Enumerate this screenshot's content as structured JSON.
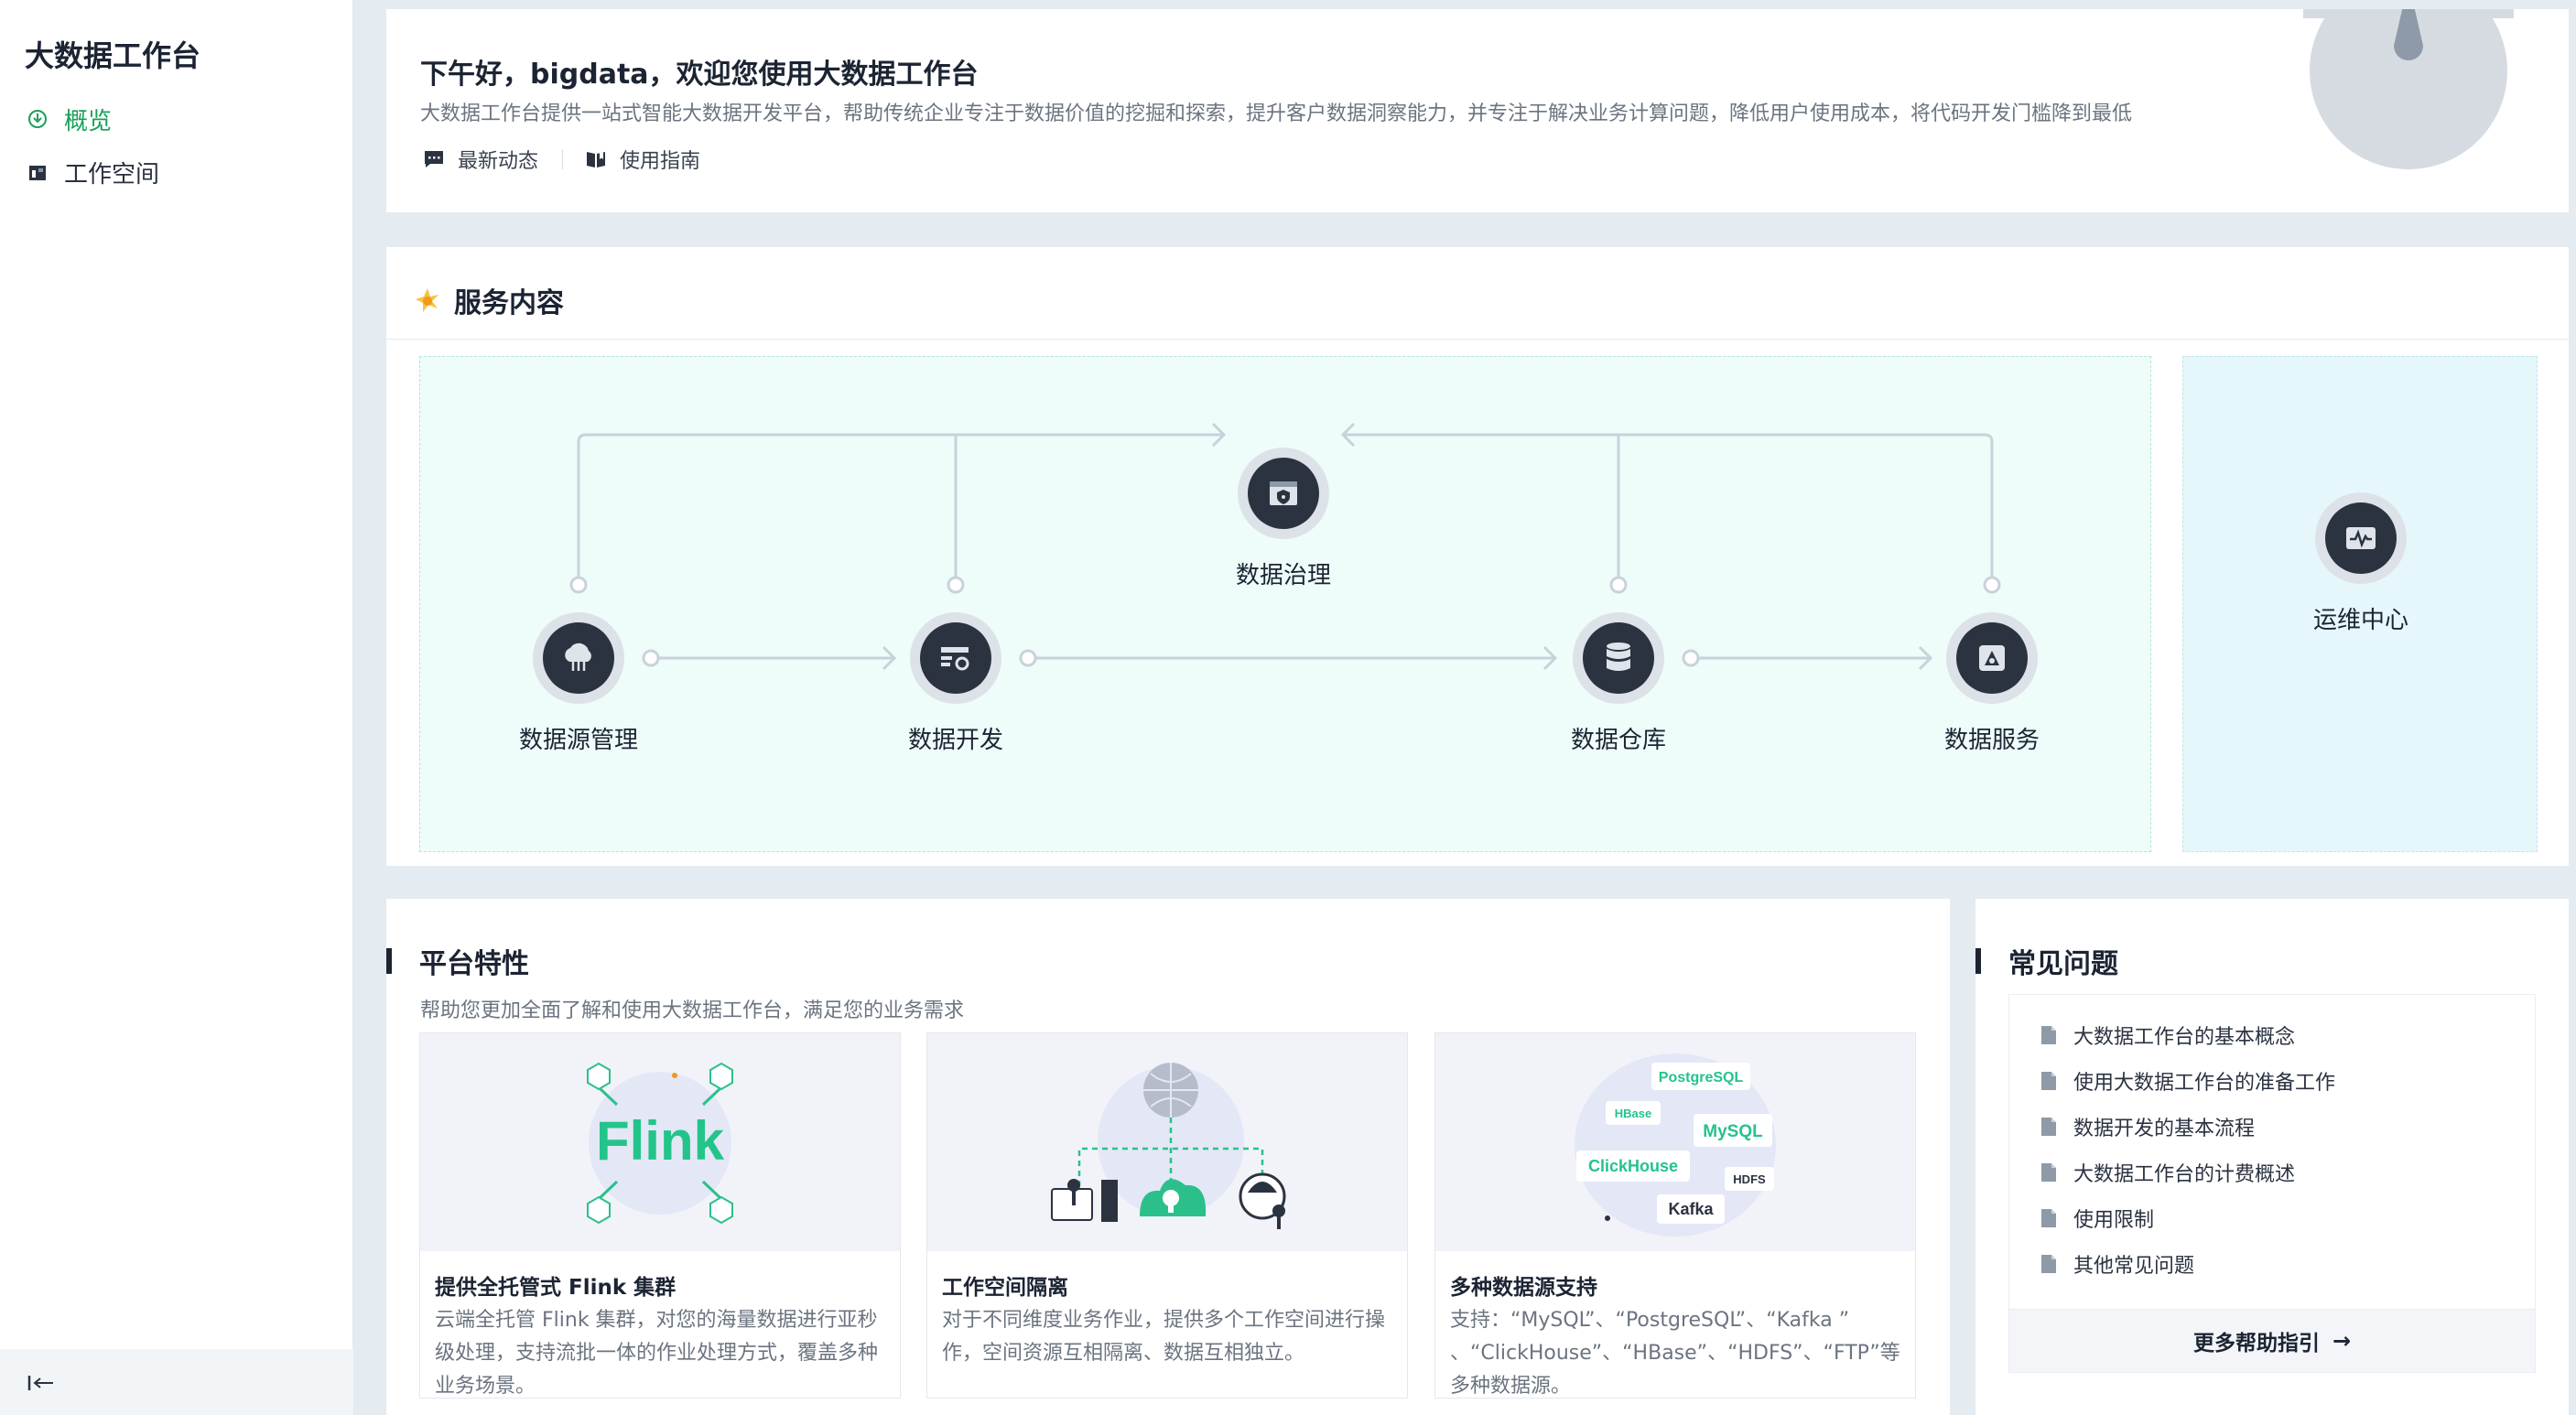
{
  "sidebar": {
    "title": "大数据工作台",
    "items": [
      {
        "label": "概览",
        "icon": "overview-icon",
        "active": true
      },
      {
        "label": "工作空间",
        "icon": "workspace-icon",
        "active": false
      }
    ],
    "collapse_icon": "collapse-sidebar-icon"
  },
  "welcome": {
    "title": "下午好，bigdata，欢迎您使用大数据工作台",
    "description": "大数据工作台提供一站式智能大数据开发平台，帮助传统企业专注于数据价值的挖掘和探索，提升客户数据洞察能力，并专注于解决业务计算问题，降低用户使用成本，将代码开发门槛降到最低",
    "links": [
      {
        "label": "最新动态",
        "icon": "message-icon"
      },
      {
        "label": "使用指南",
        "icon": "book-icon"
      }
    ]
  },
  "services": {
    "title": "服务内容",
    "nodes": {
      "source": "数据源管理",
      "dev": "数据开发",
      "governance": "数据治理",
      "warehouse": "数据仓库",
      "service": "数据服务",
      "ops": "运维中心"
    }
  },
  "features": {
    "title": "平台特性",
    "subtitle": "帮助您更加全面了解和使用大数据工作台，满足您的业务需求",
    "cards": [
      {
        "title": "提供全托管式 Flink 集群",
        "description": "云端全托管 Flink 集群，对您的海量数据进行亚秒级处理，支持流批一体的作业处理方式，覆盖多种业务场景。",
        "image_text": "Flink"
      },
      {
        "title": "工作空间隔离",
        "description": "对于不同维度业务作业，提供多个工作空间进行操作，空间资源互相隔离、数据互相独立。"
      },
      {
        "title": "多种数据源支持",
        "description": "支持：“MySQL”、“PostgreSQL”、“Kafka ” 、“ClickHouse”、“HBase”、“HDFS”、“FTP”等多种数据源。",
        "tags": [
          "PostgreSQL",
          "HBase",
          "MySQL",
          "ClickHouse",
          "HDFS",
          "Kafka"
        ]
      }
    ]
  },
  "faq": {
    "title": "常见问题",
    "items": [
      "大数据工作台的基本概念",
      "使用大数据工作台的准备工作",
      "数据开发的基本流程",
      "大数据工作台的计费概述",
      "使用限制",
      "其他常见问题"
    ],
    "more_label": "更多帮助指引",
    "more_icon": "arrow-right-icon"
  },
  "colors": {
    "accent": "#18a058",
    "node_dark": "#2b3340",
    "flow_bg": "#eefcfa",
    "ops_bg": "#e6f7fb"
  }
}
